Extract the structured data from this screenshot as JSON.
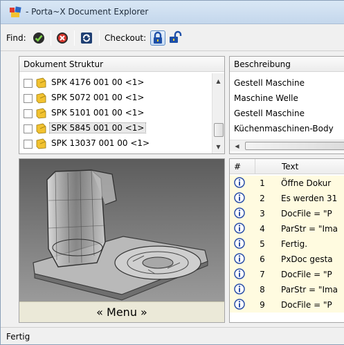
{
  "window": {
    "title": "- Porta~X Document Explorer"
  },
  "toolbar": {
    "find_label": "Find:",
    "checkout_label": "Checkout:",
    "buttons": [
      "find-ok-icon",
      "find-cancel-icon",
      "refresh-icon",
      "lock-closed-icon",
      "lock-open-icon"
    ]
  },
  "tree": {
    "header": "Dokument Struktur",
    "items": [
      {
        "label": "SPK 4176 001 00 <1>"
      },
      {
        "label": "SPK 5072 001 00 <1>"
      },
      {
        "label": "SPK 5101 001 00 <1>"
      },
      {
        "label": "SPK 5845 001 00 <1>",
        "selected": true
      },
      {
        "label": "SPK 13037 001 00 <1>"
      }
    ]
  },
  "description": {
    "header": "Beschreibung",
    "items": [
      "Gestell Maschine",
      "Maschine Welle",
      "Gestell Maschine",
      "Küchenmaschinen-Body"
    ]
  },
  "preview": {
    "menu_label": "« Menu »"
  },
  "log": {
    "columns": [
      "#",
      "Text"
    ],
    "rows": [
      {
        "num": "1",
        "text": "Öffne Dokur"
      },
      {
        "num": "2",
        "text": "Es werden 31"
      },
      {
        "num": "3",
        "text": "DocFile = \"P"
      },
      {
        "num": "4",
        "text": "ParStr = \"Ima"
      },
      {
        "num": "5",
        "text": "Fertig."
      },
      {
        "num": "6",
        "text": "PxDoc gesta"
      },
      {
        "num": "7",
        "text": "DocFile = \"P"
      },
      {
        "num": "8",
        "text": "ParStr = \"Ima"
      },
      {
        "num": "9",
        "text": "DocFile = \"P"
      }
    ]
  },
  "status": {
    "text": "Fertig"
  },
  "colors": {
    "log_row_bg": "#fffbe0",
    "info_icon": "#2b4fa8",
    "preview_bg": "#7a7a7a"
  }
}
